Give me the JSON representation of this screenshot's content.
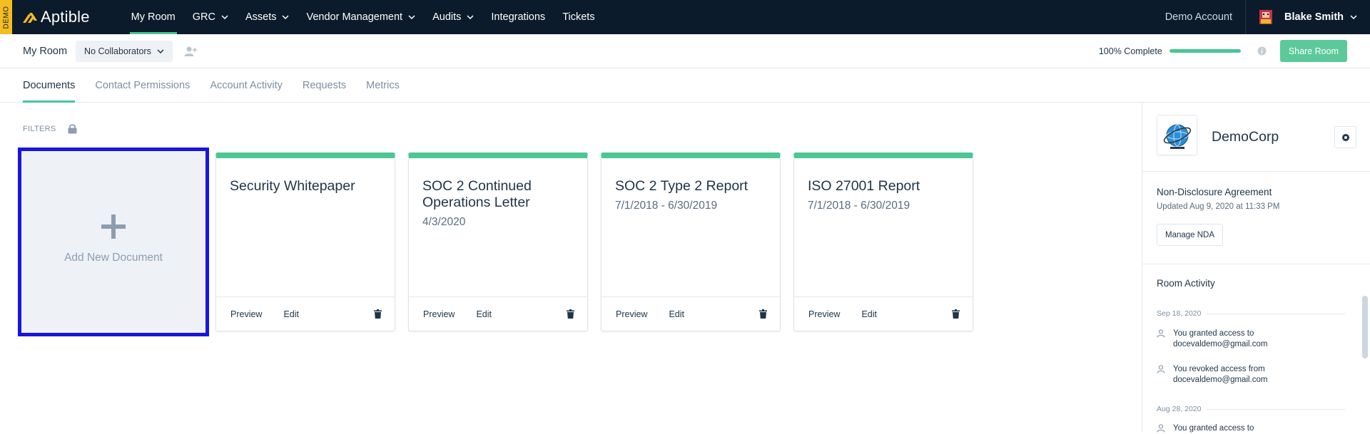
{
  "topbar": {
    "demo_tag": "DEMO",
    "app_name": "Aptible",
    "nav": [
      {
        "label": "My Room"
      },
      {
        "label": "GRC"
      },
      {
        "label": "Assets"
      },
      {
        "label": "Vendor Management"
      },
      {
        "label": "Audits"
      },
      {
        "label": "Integrations"
      },
      {
        "label": "Tickets"
      }
    ],
    "account_label": "Demo Account",
    "user_name": "Blake Smith"
  },
  "roombar": {
    "title": "My Room",
    "collaborators_label": "No Collaborators",
    "progress_label": "100% Complete",
    "progress_fraction": 1.0,
    "share_label": "Share Room"
  },
  "tabs": [
    {
      "label": "Documents"
    },
    {
      "label": "Contact Permissions"
    },
    {
      "label": "Account Activity"
    },
    {
      "label": "Requests"
    },
    {
      "label": "Metrics"
    }
  ],
  "filters_label": "FILTERS",
  "add_document_label": "Add New Document",
  "documents": [
    {
      "title": "Security Whitepaper",
      "date": "",
      "preview": "Preview",
      "edit": "Edit"
    },
    {
      "title": "SOC 2 Continued Operations Letter",
      "date": "4/3/2020",
      "preview": "Preview",
      "edit": "Edit"
    },
    {
      "title": "SOC 2 Type 2 Report",
      "date": "7/1/2018 - 6/30/2019",
      "preview": "Preview",
      "edit": "Edit"
    },
    {
      "title": "ISO 27001 Report",
      "date": "7/1/2018 - 6/30/2019",
      "preview": "Preview",
      "edit": "Edit"
    }
  ],
  "panel": {
    "company_name": "DemoCorp",
    "nda_title": "Non-Disclosure Agreement",
    "nda_updated": "Updated Aug 9, 2020 at 11:33 PM",
    "nda_button": "Manage NDA",
    "activity_title": "Room Activity",
    "activity": [
      {
        "date": "Sep 18, 2020",
        "items": [
          "You granted access to docevaldemo@gmail.com",
          "You revoked access from docevaldemo@gmail.com"
        ]
      },
      {
        "date": "Aug 28, 2020",
        "items": [
          "You granted access to"
        ]
      }
    ]
  },
  "colors": {
    "nav_bg": "#0b1b2b",
    "accent_green": "#46c696",
    "demo_yellow": "#f5bd1f",
    "selection_blue": "#1a14e0"
  }
}
